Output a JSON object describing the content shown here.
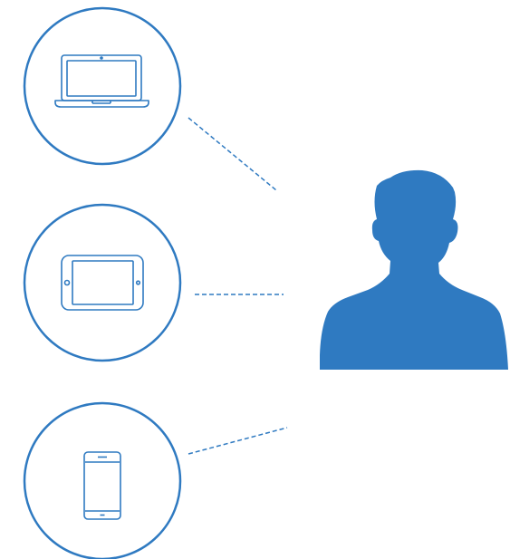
{
  "colors": {
    "accent": "#2f7ac1",
    "background": "#ffffff"
  },
  "devices": [
    {
      "icon": "laptop-icon"
    },
    {
      "icon": "tablet-icon"
    },
    {
      "icon": "smartphone-icon"
    }
  ],
  "user": {
    "icon": "user-silhouette-icon"
  }
}
